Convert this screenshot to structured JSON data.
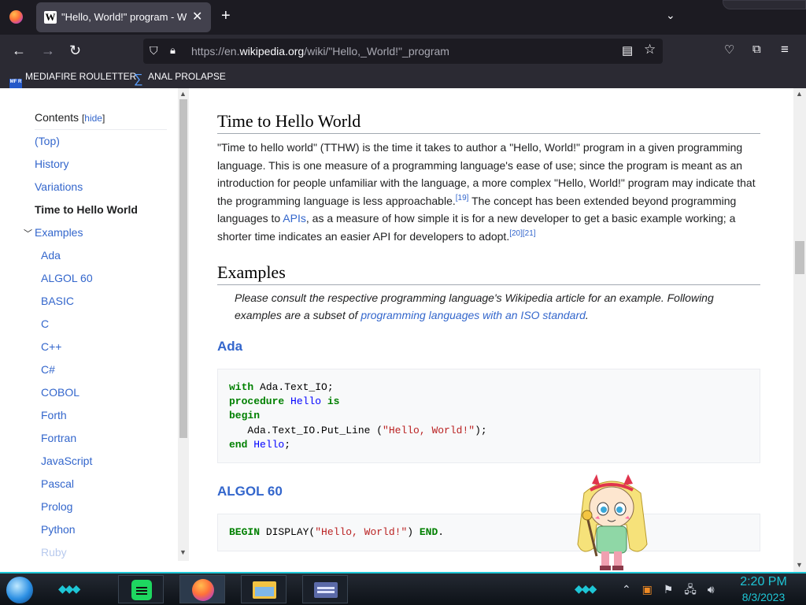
{
  "browser": {
    "tab_title": "\"Hello, World!\" program - Wiki",
    "tab_favicon": "W",
    "url_domain_prefix": "https://en.",
    "url_domain": "wikipedia.org",
    "url_path": "/wiki/\"Hello,_World!\"_program"
  },
  "bookmarks": [
    {
      "label": "MEDIAFIRE ROULETTER",
      "icon_text": "MF R"
    },
    {
      "label": "ANAL PROLAPSE"
    }
  ],
  "toc": {
    "heading": "Contents",
    "hide_label": "hide",
    "items": [
      {
        "label": "(Top)"
      },
      {
        "label": "History"
      },
      {
        "label": "Variations"
      },
      {
        "label": "Time to Hello World",
        "active": true
      },
      {
        "label": "Examples"
      },
      {
        "label": "Ada"
      },
      {
        "label": "ALGOL 60"
      },
      {
        "label": "BASIC"
      },
      {
        "label": "C"
      },
      {
        "label": "C++"
      },
      {
        "label": "C#"
      },
      {
        "label": "COBOL"
      },
      {
        "label": "Forth"
      },
      {
        "label": "Fortran"
      },
      {
        "label": "JavaScript"
      },
      {
        "label": "Pascal"
      },
      {
        "label": "Prolog"
      },
      {
        "label": "Python"
      },
      {
        "label": "Ruby"
      }
    ]
  },
  "article": {
    "section1_title": "Time to Hello World",
    "section1_p1": "\"Time to hello world\" (TTHW) is the time it takes to author a \"Hello, World!\" program in a given programming language. This is one measure of a programming language's ease of use; since the program is meant as an introduction for people unfamiliar with the language, a more complex \"Hello, World!\" program may indicate that the programming language is less approachable.",
    "cite1": "[19]",
    "section1_p2": " The concept has been extended beyond programming languages to ",
    "apis_link": "APIs",
    "section1_p3": ", as a measure of how simple it is for a new developer to get a basic example working; a shorter time indicates an easier API for developers to adopt.",
    "cite2": "[20][21]",
    "section2_title": "Examples",
    "note_text": "Please consult the respective programming language's Wikipedia article for an example. Following examples are a subset of ",
    "note_link": "programming languages with an ISO standard",
    "note_end": ".",
    "ada_title": "Ada",
    "algol_title": "ALGOL 60"
  },
  "taskbar": {
    "time": "2:20 PM",
    "date": "8/3/2023",
    "accent": "#1ec6d6"
  }
}
